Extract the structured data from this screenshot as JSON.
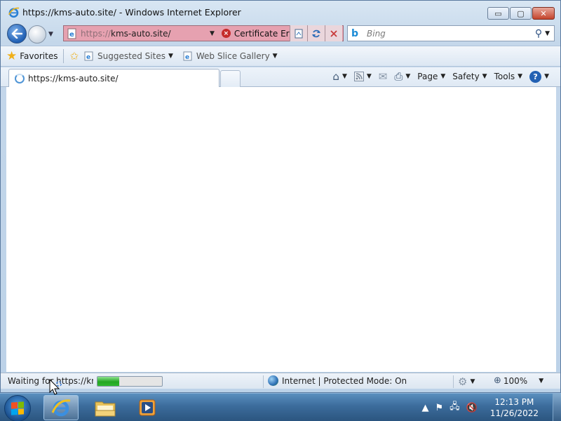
{
  "window": {
    "title": "https://kms-auto.site/ - Windows Internet Explorer",
    "minimize_glyph": "▭",
    "maximize_glyph": "▢",
    "close_glyph": "✕"
  },
  "nav": {
    "address_protocol": "https://",
    "address_host": "kms-auto.site/",
    "certificate_label": "Certificate Error",
    "search_placeholder": "Bing",
    "search_button_glyph": "⚲"
  },
  "favorites_bar": {
    "favorites_label": "Favorites",
    "suggested_sites_label": "Suggested Sites",
    "web_slice_label": "Web Slice Gallery"
  },
  "tabs": {
    "active_tab_label": "https://kms-auto.site/"
  },
  "command_bar": {
    "page_label": "Page",
    "safety_label": "Safety",
    "tools_label": "Tools",
    "help_glyph": "?"
  },
  "status": {
    "text": "Waiting for https://kms",
    "progress": 0.34,
    "zone_text": "Internet | Protected Mode: On",
    "zoom": "100%"
  },
  "taskbar": {
    "time": "12:13 PM",
    "date": "11/26/2022"
  },
  "colors": {
    "cert_error_bg": "#e6a1b0",
    "progress_green": "#23a623",
    "taskbar_blue": "#3c6c9c"
  }
}
